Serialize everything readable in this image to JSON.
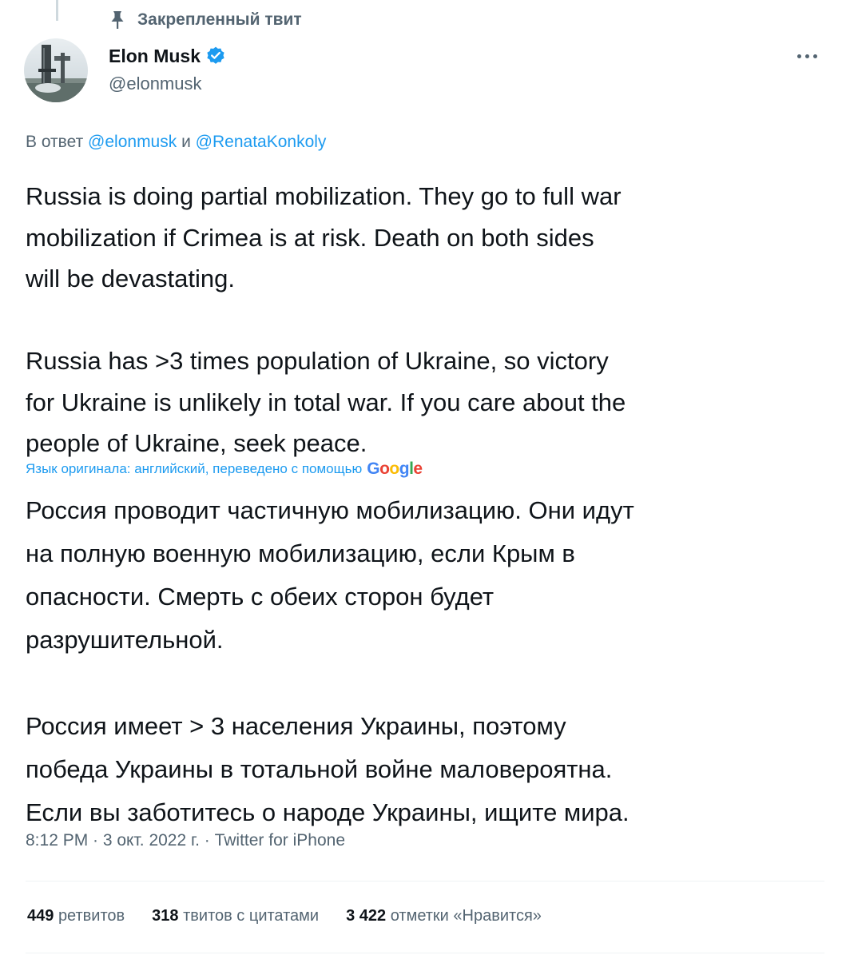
{
  "pinned": {
    "label": "Закрепленный твит",
    "icon": "pin-icon"
  },
  "author": {
    "name": "Elon Musk",
    "handle": "@elonmusk",
    "verified": true,
    "verified_color": "#1d9bf0"
  },
  "reply_to": {
    "prefix": "В ответ",
    "mention1": "@elonmusk",
    "conjunction": "и",
    "mention2": "@RenataKonkoly"
  },
  "tweet": {
    "lines": [
      "Russia is doing partial mobilization. They go to full war",
      "mobilization if Crimea is at risk. Death on both sides",
      "will be devastating.",
      "",
      "Russia has >3 times population of Ukraine, so victory",
      "for Ukraine is unlikely in total war. If you care about the",
      "people of Ukraine, seek peace."
    ]
  },
  "translation": {
    "note": "Язык оригинала: английский, переведено с помощью",
    "provider_letters": [
      "G",
      "o",
      "o",
      "g",
      "l",
      "e"
    ],
    "lines": [
      "Россия проводит частичную мобилизацию. Они идут",
      "на полную военную мобилизацию, если Крым в",
      "опасности. Смерть с обеих сторон будет",
      "разрушительной.",
      "",
      "Россия имеет > 3 населения Украины, поэтому",
      "победа Украины в тотальной войне маловероятна.",
      "Если вы заботитесь о народе Украины, ищите мира."
    ]
  },
  "meta": {
    "time": "8:12 PM · 3 окт. 2022 г. · Twitter for iPhone"
  },
  "stats": {
    "retweets_count": "449",
    "retweets_label": "ретвитов",
    "quotes_count": "318",
    "quotes_label": "твитов с цитатами",
    "likes_count": "3 422",
    "likes_label": "отметки «Нравится»"
  },
  "colors": {
    "text": "#0f1419",
    "secondary": "#536471",
    "accent": "#1d9bf0",
    "divider": "#eff3f4"
  }
}
